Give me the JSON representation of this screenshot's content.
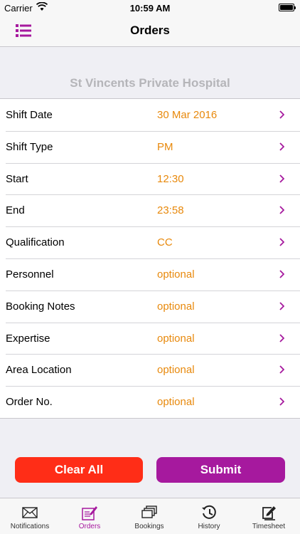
{
  "status_bar": {
    "carrier": "Carrier",
    "time": "10:59 AM"
  },
  "nav": {
    "title": "Orders"
  },
  "hospital_name": "St Vincents Private Hospital",
  "form_rows": [
    {
      "label": "Shift Date",
      "value": "30 Mar 2016"
    },
    {
      "label": "Shift Type",
      "value": "PM"
    },
    {
      "label": "Start",
      "value": "12:30"
    },
    {
      "label": "End",
      "value": "23:58"
    },
    {
      "label": "Qualification",
      "value": "CC"
    },
    {
      "label": "Personnel",
      "value": "optional"
    },
    {
      "label": "Booking Notes",
      "value": "optional"
    },
    {
      "label": "Expertise",
      "value": "optional"
    },
    {
      "label": "Area Location",
      "value": "optional"
    },
    {
      "label": "Order No.",
      "value": "optional"
    }
  ],
  "buttons": {
    "clear": "Clear All",
    "submit": "Submit"
  },
  "tabs": [
    {
      "label": "Notifications",
      "icon": "envelope-icon",
      "active": false
    },
    {
      "label": "Orders",
      "icon": "clipboard-pen-icon",
      "active": true
    },
    {
      "label": "Bookings",
      "icon": "stacked-cards-icon",
      "active": false
    },
    {
      "label": "History",
      "icon": "history-clock-icon",
      "active": false
    },
    {
      "label": "Timesheet",
      "icon": "edit-sheet-icon",
      "active": false
    }
  ],
  "colors": {
    "accent": "#a6199e",
    "value_orange": "#e8890c",
    "clear_red": "#ff2d17",
    "hospital_gray": "#b5b5b9"
  }
}
